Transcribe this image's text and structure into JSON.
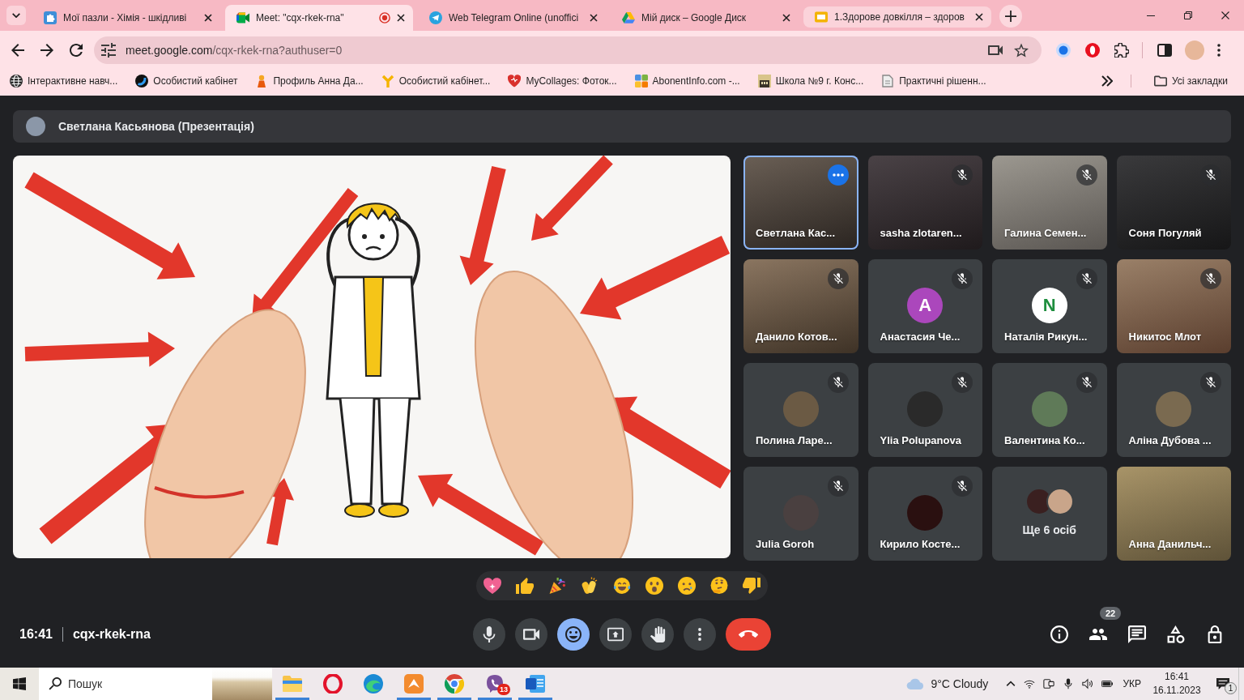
{
  "browser": {
    "tabs": [
      {
        "title": "Мої пазли - Хімія - шкідливі",
        "selected": false,
        "hovered": false,
        "recording": false
      },
      {
        "title": "Meet: \"cqx-rkek-rna\"",
        "selected": true,
        "hovered": false,
        "recording": true
      },
      {
        "title": "Web Telegram Online (unoffici",
        "selected": false,
        "hovered": false,
        "recording": false
      },
      {
        "title": "Мій диск – Google Диск",
        "selected": false,
        "hovered": false,
        "recording": false
      },
      {
        "title": "1.Здорове довкілля – здоров",
        "selected": false,
        "hovered": true,
        "recording": false
      }
    ],
    "address_bar": {
      "host": "meet.google.com",
      "path": "/cqx-rkek-rna?authuser=0"
    },
    "bookmarks": [
      {
        "title": "Інтерактивне навч..."
      },
      {
        "title": "Особистий кабінет"
      },
      {
        "title": "Профиль Анна Да..."
      },
      {
        "title": "Особистий кабінет..."
      },
      {
        "title": "MyCollages: Фоток..."
      },
      {
        "title": "AbonentInfo.com -..."
      },
      {
        "title": "Школа №9 г. Конс..."
      },
      {
        "title": "Практичні рішенн..."
      }
    ],
    "all_bookmarks": "Усі закладки"
  },
  "meet": {
    "presenter": "Светлана Касьянова (Презентація)",
    "participants": [
      {
        "name": "Светлана Кас...",
        "kind": "video",
        "muted": false,
        "selected": true
      },
      {
        "name": "sasha zlotaren...",
        "kind": "video",
        "muted": true,
        "selected": false
      },
      {
        "name": "Галина Семен...",
        "kind": "video",
        "muted": true,
        "selected": false
      },
      {
        "name": "Соня Погуляй",
        "kind": "video",
        "muted": true,
        "selected": false
      },
      {
        "name": "Данило Котов...",
        "kind": "video",
        "muted": true,
        "selected": false
      },
      {
        "name": "Анастасия Че...",
        "kind": "letter",
        "letter": "А",
        "color": "#ab47bc",
        "muted": true,
        "selected": false
      },
      {
        "name": "Наталія Рикун...",
        "kind": "letter",
        "letter": "N",
        "color": "#ffffff",
        "muted": true,
        "selected": false
      },
      {
        "name": "Никитос Млот",
        "kind": "video",
        "muted": true,
        "selected": false
      },
      {
        "name": "Полина Ларе...",
        "kind": "photo",
        "muted": true,
        "selected": false
      },
      {
        "name": "Ylia Polupanova",
        "kind": "photo",
        "muted": true,
        "selected": false
      },
      {
        "name": "Валентина Ко...",
        "kind": "photo",
        "muted": true,
        "selected": false
      },
      {
        "name": "Аліна Дубова ...",
        "kind": "photo",
        "muted": true,
        "selected": false
      },
      {
        "name": "Julia Goroh",
        "kind": "photo",
        "muted": true,
        "selected": false
      },
      {
        "name": "Кирило Косте...",
        "kind": "photo",
        "muted": true,
        "selected": false
      },
      {
        "name": "Ще 6 осіб",
        "kind": "others",
        "muted": false,
        "selected": false
      },
      {
        "name": "Анна Данильч...",
        "kind": "video",
        "muted": false,
        "selected": false
      }
    ],
    "time": "16:41",
    "meeting_code": "cqx-rkek-rna",
    "call_controls": [
      {
        "kind": "microphone",
        "on": true
      },
      {
        "kind": "camera",
        "on": true
      },
      {
        "kind": "reactions",
        "on": true
      },
      {
        "kind": "present",
        "on": false
      },
      {
        "kind": "raise_hand",
        "on": false
      },
      {
        "kind": "more",
        "on": false
      }
    ],
    "participant_count": "22"
  },
  "taskbar": {
    "search": {
      "placeholder": "Пошук"
    },
    "apps": [
      {
        "kind": "folder",
        "running": true
      },
      {
        "kind": "ring",
        "running": false
      },
      {
        "kind": "wave",
        "running": false
      },
      {
        "kind": "tile",
        "running": true
      },
      {
        "kind": "tricolor",
        "running": true
      },
      {
        "kind": "bubble",
        "running": true,
        "badge": "13"
      },
      {
        "kind": "document",
        "running": true
      }
    ],
    "weather": "9°C Cloudy",
    "language": "УКР",
    "time": "16:41",
    "date": "16.11.2023",
    "notification_count": "1"
  }
}
